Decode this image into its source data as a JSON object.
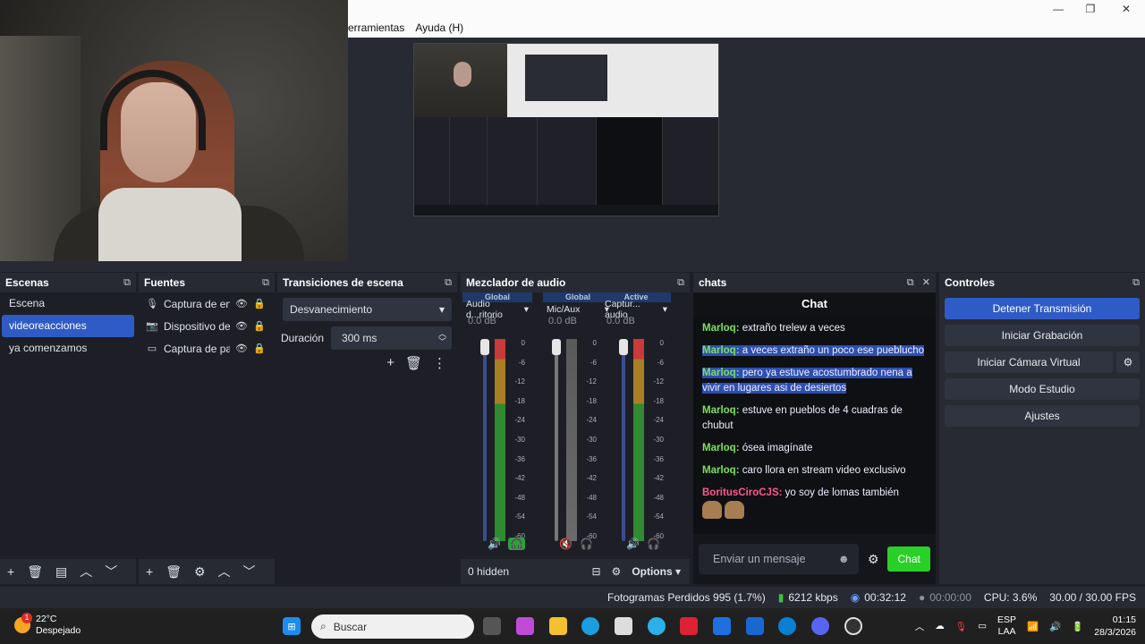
{
  "menu": {
    "items": [
      "erramientas",
      "Ayuda (H)"
    ]
  },
  "window": {
    "min": "—",
    "max": "❐",
    "close": "✕"
  },
  "docks": {
    "scenes": {
      "title": "Escenas",
      "items": [
        "Escena",
        "videoreacciones",
        "ya comenzamos"
      ],
      "selected_index": 1
    },
    "sources": {
      "title": "Fuentes",
      "items": [
        {
          "icon": "mic-icon",
          "label": "Captura de ent"
        },
        {
          "icon": "camera-icon",
          "label": "Dispositivo de"
        },
        {
          "icon": "monitor-icon",
          "label": "Captura de par"
        }
      ]
    },
    "transitions": {
      "title": "Transiciones de escena",
      "selected": "Desvanecimiento",
      "duration_label": "Duración",
      "duration_value": "300 ms"
    },
    "mixer": {
      "title": "Mezclador de audio",
      "channels": [
        {
          "tag": "Global",
          "name": "Audio d...ritorio",
          "db": "0.0 dB",
          "level": 0.68
        },
        {
          "tag": "Global",
          "name": "Mic/Aux",
          "db": "0.0 dB",
          "level": 0.0
        },
        {
          "tag": "Active",
          "name": "Captur... audio",
          "db": "0.0 dB",
          "level": 0.68
        }
      ],
      "scale": [
        "0",
        "-6",
        "-12",
        "-18",
        "-24",
        "-30",
        "-36",
        "-42",
        "-48",
        "-54",
        "-60"
      ],
      "hidden_label": "0 hidden",
      "options_label": "Options"
    },
    "chats": {
      "title": "chats",
      "header": "Chat",
      "messages": [
        {
          "user": "Marloq",
          "text": "extraño trelew a veces",
          "highlight": false,
          "color": "green"
        },
        {
          "user": "Marloq",
          "text": "a veces extraño un poco ese pueblucho",
          "highlight": true,
          "color": "green"
        },
        {
          "user": "Marloq",
          "text": "pero ya estuve acostumbrado nena a vivir en lugares asi de desiertos",
          "highlight": true,
          "color": "green"
        },
        {
          "user": "Marloq",
          "text": "estuve en pueblos de 4 cuadras de chubut",
          "highlight": false,
          "color": "green"
        },
        {
          "user": "Marloq",
          "text": "ósea imagínate",
          "highlight": false,
          "color": "green"
        },
        {
          "user": "Marloq",
          "text": "caro llora en stream video exclusivo",
          "highlight": false,
          "color": "green"
        },
        {
          "user": "BoritusCiroCJS",
          "text": "yo soy de lomas también",
          "highlight": false,
          "color": "pink"
        }
      ],
      "input_placeholder": "Enviar un mensaje",
      "send_label": "Chat"
    },
    "controls": {
      "title": "Controles",
      "buttons": [
        "Detener Transmisión",
        "Iniciar Grabación",
        "Iniciar Cámara Virtual",
        "Modo Estudio",
        "Ajustes"
      ]
    }
  },
  "status": {
    "dropped": "Fotogramas Perdidos 995 (1.7%)",
    "bitrate": "6212 kbps",
    "stream_time": "00:32:12",
    "rec_time": "00:00:00",
    "cpu": "CPU: 3.6%",
    "fps": "30.00 / 30.00 FPS"
  },
  "taskbar": {
    "temp": "22°C",
    "weather": "Despejado",
    "badge": "1",
    "search_placeholder": "Buscar",
    "lang": "ESP",
    "lang2": "LAA",
    "time": "01:15",
    "date": "28/3/2026"
  }
}
